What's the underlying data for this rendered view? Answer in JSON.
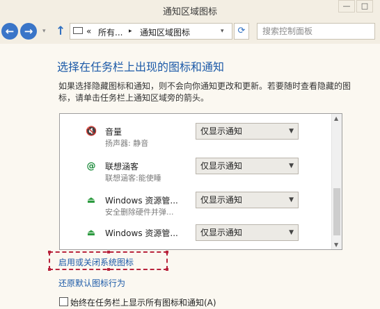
{
  "window": {
    "title": "通知区域图标",
    "minimize_glyph": "—",
    "maximize_glyph": "□"
  },
  "nav": {
    "back_glyph": "←",
    "forward_glyph": "→",
    "recent_glyph": "▾",
    "up_glyph": "↑",
    "breadcrumb": {
      "overflow": "«",
      "segment1": "所有...",
      "separator": "▸",
      "segment2": "通知区域图标"
    },
    "dropdown_glyph": "▾",
    "refresh_glyph": "⟳",
    "search_placeholder": "搜索控制面板"
  },
  "main": {
    "heading": "选择在任务栏上出现的图标和通知",
    "description": "如果选择隐藏图标和通知，则不会向你通知更改和更新。若要随时查看隐藏的图标，请单击任务栏上通知区域旁的箭头。"
  },
  "icons_list": [
    {
      "icon": "speaker-muted-icon",
      "glyph": "🔇",
      "name": "音量",
      "detail": "扬声器: 静音",
      "behavior": "仅显示通知"
    },
    {
      "icon": "lenovo-shield-icon",
      "glyph": "@",
      "name": "联想涵客",
      "detail": "联想涵客:能使睡",
      "behavior": "仅显示通知"
    },
    {
      "icon": "safely-remove-hardware-icon",
      "glyph": "⏏",
      "name": "Windows 资源管...",
      "detail": "安全删除硬件并弹...",
      "behavior": "仅显示通知"
    },
    {
      "icon": "safely-remove-hardware-icon",
      "glyph": "⏏",
      "name": "Windows 资源管...",
      "detail": "",
      "behavior": "仅显示通知"
    }
  ],
  "select_caret": "▼",
  "scroll": {
    "up_glyph": "▲",
    "down_glyph": "▼",
    "position_fraction": 0.6
  },
  "links": {
    "system_icons": "启用或关闭系统图标",
    "restore_defaults": "还原默认图标行为"
  },
  "checkbox": {
    "label": "始终在任务栏上显示所有图标和通知(A)",
    "checked": false
  },
  "colors": {
    "accent": "#1c5aa8",
    "highlight_border": "#b8233c"
  }
}
